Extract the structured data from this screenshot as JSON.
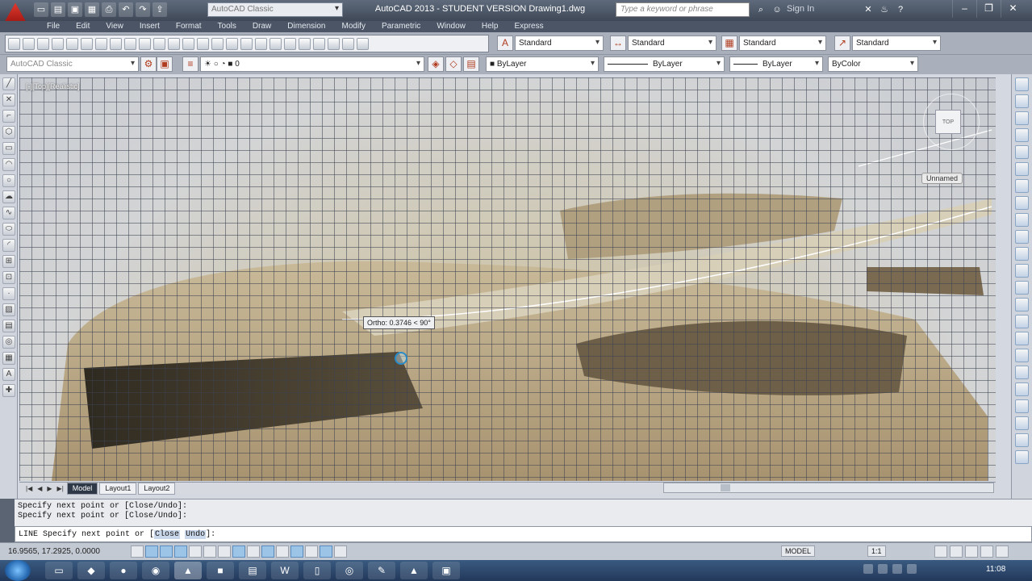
{
  "title_bar": {
    "workspace": "AutoCAD Classic",
    "title": "AutoCAD 2013 - STUDENT VERSION   Drawing1.dwg",
    "search_placeholder": "Type a keyword or phrase",
    "sign_in": "Sign In"
  },
  "menu": [
    "File",
    "Edit",
    "View",
    "Insert",
    "Format",
    "Tools",
    "Draw",
    "Dimension",
    "Modify",
    "Parametric",
    "Window",
    "Help",
    "Express"
  ],
  "styles": {
    "text_style": "Standard",
    "dim_style": "Standard",
    "table_style": "Standard",
    "multileader_style": "Standard"
  },
  "workspace_bar": {
    "workspace": "AutoCAD Classic",
    "layer": "0",
    "color": "ByLayer",
    "linetype": "ByLayer",
    "lineweight": "ByLayer",
    "plotstyle": "ByColor"
  },
  "viewport": {
    "view_label": "[-][Top][Realistic]",
    "viewcube_face": "TOP",
    "ucs_label": "Unnamed",
    "tooltip": "Ortho: 0.3746 < 90°"
  },
  "layout_tabs": [
    "Model",
    "Layout1",
    "Layout2"
  ],
  "command": {
    "history": [
      "Specify next point or [Close/Undo]:",
      "Specify next point or [Close/Undo]:"
    ],
    "prompt_prefix": "LINE Specify next point or [",
    "opt_close": "Close",
    "opt_undo": "Undo",
    "prompt_suffix": "]:"
  },
  "status": {
    "coordinates": "16.9565, 17.2925, 0.0000",
    "space": "MODEL",
    "annotation_scale": "1:1",
    "clock": "11:08"
  },
  "colors": {
    "titlebar": "#4a5566",
    "tooltip_border": "#555555",
    "cursor": "#2a8bc7"
  }
}
